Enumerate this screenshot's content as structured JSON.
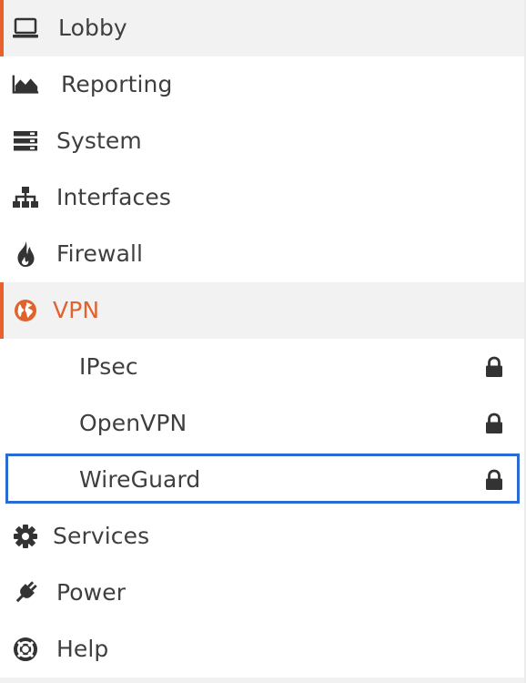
{
  "nav": {
    "items": [
      {
        "label": "Lobby",
        "icon": "laptop-icon"
      },
      {
        "label": "Reporting",
        "icon": "area-chart-icon"
      },
      {
        "label": "System",
        "icon": "server-icon"
      },
      {
        "label": "Interfaces",
        "icon": "sitemap-icon"
      },
      {
        "label": "Firewall",
        "icon": "fire-icon"
      },
      {
        "label": "VPN",
        "icon": "globe-icon"
      },
      {
        "label": "Services",
        "icon": "gear-icon"
      },
      {
        "label": "Power",
        "icon": "plug-icon"
      },
      {
        "label": "Help",
        "icon": "life-ring-icon"
      }
    ],
    "vpn_children": [
      {
        "label": "IPsec",
        "icon": "lock-icon"
      },
      {
        "label": "OpenVPN",
        "icon": "lock-icon"
      },
      {
        "label": "WireGuard",
        "icon": "lock-icon"
      }
    ],
    "active_section": "VPN",
    "selected_child": "WireGuard"
  },
  "colors": {
    "accent": "#e8602a",
    "text": "#3f3f3f",
    "active_background": "#f2f2f2",
    "focus_outline": "#2a6ad3"
  }
}
